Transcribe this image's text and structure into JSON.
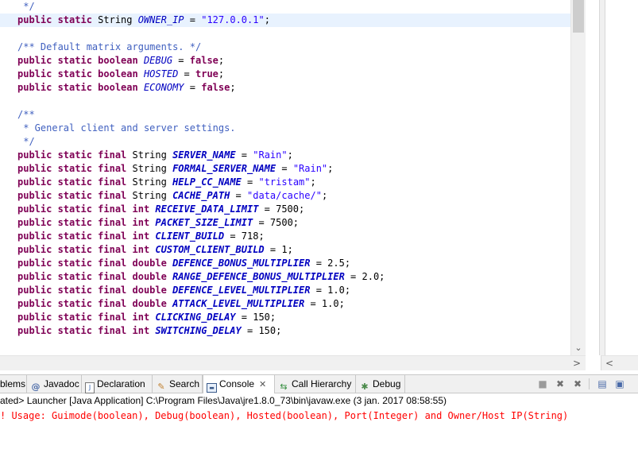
{
  "editor": {
    "lines": [
      {
        "parts": [
          {
            "t": "cm",
            "v": " */"
          }
        ]
      },
      {
        "current": true,
        "parts": [
          {
            "t": "kw",
            "v": "public static "
          },
          {
            "t": "ty",
            "v": "String "
          },
          {
            "t": "const",
            "v": "OWNER_IP"
          },
          {
            "t": "ty",
            "v": " = "
          },
          {
            "t": "str",
            "v": "\"127.0.0.1\""
          },
          {
            "t": "ty",
            "v": ";"
          }
        ]
      },
      {
        "parts": []
      },
      {
        "parts": [
          {
            "t": "cm",
            "v": "/** Default matrix arguments. */"
          }
        ]
      },
      {
        "parts": [
          {
            "t": "kw",
            "v": "public static boolean "
          },
          {
            "t": "const",
            "v": "DEBUG"
          },
          {
            "t": "ty",
            "v": " = "
          },
          {
            "t": "kw",
            "v": "false"
          },
          {
            "t": "ty",
            "v": ";"
          }
        ]
      },
      {
        "parts": [
          {
            "t": "kw",
            "v": "public static boolean "
          },
          {
            "t": "const",
            "v": "HOSTED"
          },
          {
            "t": "ty",
            "v": " = "
          },
          {
            "t": "kw",
            "v": "true"
          },
          {
            "t": "ty",
            "v": ";"
          }
        ]
      },
      {
        "parts": [
          {
            "t": "kw",
            "v": "public static boolean "
          },
          {
            "t": "const",
            "v": "ECONOMY"
          },
          {
            "t": "ty",
            "v": " = "
          },
          {
            "t": "kw",
            "v": "false"
          },
          {
            "t": "ty",
            "v": ";"
          }
        ]
      },
      {
        "parts": []
      },
      {
        "parts": [
          {
            "t": "cm",
            "v": "/**"
          }
        ]
      },
      {
        "parts": [
          {
            "t": "cm",
            "v": " * General client and server settings."
          }
        ]
      },
      {
        "parts": [
          {
            "t": "cm",
            "v": " */"
          }
        ]
      },
      {
        "parts": [
          {
            "t": "kw",
            "v": "public static final "
          },
          {
            "t": "ty",
            "v": "String "
          },
          {
            "t": "constb",
            "v": "SERVER_NAME"
          },
          {
            "t": "ty",
            "v": " = "
          },
          {
            "t": "str",
            "v": "\"Rain\""
          },
          {
            "t": "ty",
            "v": ";"
          }
        ]
      },
      {
        "parts": [
          {
            "t": "kw",
            "v": "public static final "
          },
          {
            "t": "ty",
            "v": "String "
          },
          {
            "t": "constb",
            "v": "FORMAL_SERVER_NAME"
          },
          {
            "t": "ty",
            "v": " = "
          },
          {
            "t": "str",
            "v": "\"Rain\""
          },
          {
            "t": "ty",
            "v": ";"
          }
        ]
      },
      {
        "parts": [
          {
            "t": "kw",
            "v": "public static final "
          },
          {
            "t": "ty",
            "v": "String "
          },
          {
            "t": "constb",
            "v": "HELP_CC_NAME"
          },
          {
            "t": "ty",
            "v": " = "
          },
          {
            "t": "str",
            "v": "\"tristam\""
          },
          {
            "t": "ty",
            "v": ";"
          }
        ]
      },
      {
        "parts": [
          {
            "t": "kw",
            "v": "public static final "
          },
          {
            "t": "ty",
            "v": "String "
          },
          {
            "t": "constb",
            "v": "CACHE_PATH"
          },
          {
            "t": "ty",
            "v": " = "
          },
          {
            "t": "str",
            "v": "\"data/cache/\""
          },
          {
            "t": "ty",
            "v": ";"
          }
        ]
      },
      {
        "parts": [
          {
            "t": "kw",
            "v": "public static final int "
          },
          {
            "t": "constb",
            "v": "RECEIVE_DATA_LIMIT"
          },
          {
            "t": "ty",
            "v": " = 7500;"
          }
        ]
      },
      {
        "parts": [
          {
            "t": "kw",
            "v": "public static final int "
          },
          {
            "t": "constb",
            "v": "PACKET_SIZE_LIMIT"
          },
          {
            "t": "ty",
            "v": " = 7500;"
          }
        ]
      },
      {
        "parts": [
          {
            "t": "kw",
            "v": "public static final int "
          },
          {
            "t": "constb",
            "v": "CLIENT_BUILD"
          },
          {
            "t": "ty",
            "v": " = 718;"
          }
        ]
      },
      {
        "parts": [
          {
            "t": "kw",
            "v": "public static final int "
          },
          {
            "t": "constb",
            "v": "CUSTOM_CLIENT_BUILD"
          },
          {
            "t": "ty",
            "v": " = 1;"
          }
        ]
      },
      {
        "parts": [
          {
            "t": "kw",
            "v": "public static final double "
          },
          {
            "t": "constb",
            "v": "DEFENCE_BONUS_MULTIPLIER"
          },
          {
            "t": "ty",
            "v": " = 2.5;"
          }
        ]
      },
      {
        "parts": [
          {
            "t": "kw",
            "v": "public static final double "
          },
          {
            "t": "constb",
            "v": "RANGE_DEFENCE_BONUS_MULTIPLIER"
          },
          {
            "t": "ty",
            "v": " = 2.0;"
          }
        ]
      },
      {
        "parts": [
          {
            "t": "kw",
            "v": "public static final double "
          },
          {
            "t": "constb",
            "v": "DEFENCE_LEVEL_MULTIPLIER"
          },
          {
            "t": "ty",
            "v": " = 1.0;"
          }
        ]
      },
      {
        "parts": [
          {
            "t": "kw",
            "v": "public static final double "
          },
          {
            "t": "constb",
            "v": "ATTACK_LEVEL_MULTIPLIER"
          },
          {
            "t": "ty",
            "v": " = 1.0;"
          }
        ]
      },
      {
        "parts": [
          {
            "t": "kw",
            "v": "public static final int "
          },
          {
            "t": "constb",
            "v": "CLICKING_DELAY"
          },
          {
            "t": "ty",
            "v": " = 150;"
          }
        ]
      },
      {
        "parts": [
          {
            "t": "kw",
            "v": "public static final int "
          },
          {
            "t": "constb",
            "v": "SWITCHING_DELAY"
          },
          {
            "t": "ty",
            "v": " = 150;"
          }
        ]
      }
    ]
  },
  "tabs": {
    "problems": "blems",
    "javadoc": "Javadoc",
    "declaration": "Declaration",
    "search": "Search",
    "console": "Console",
    "console_close": "✕",
    "call_hierarchy": "Call Hierarchy",
    "debug": "Debug"
  },
  "icons": {
    "problems": "problems-icon",
    "javadoc": "javadoc-icon",
    "declaration": "declaration-icon",
    "search": "search-icon",
    "console": "console-icon",
    "call_hierarchy": "call-hierarchy-icon",
    "debug": "debug-icon"
  },
  "toolbar": {
    "terminate": "■",
    "remove_launch": "✖",
    "remove_all": "✖",
    "scroll_lock": "▤",
    "pin": "▣"
  },
  "console": {
    "header": "ated> Launcher [Java Application] C:\\Program Files\\Java\\jre1.8.0_73\\bin\\javaw.exe (3 jan. 2017 08:58:55)",
    "output": "! Usage: Guimode(boolean), Debug(boolean), Hosted(boolean), Port(Integer) and Owner/Host IP(String)"
  },
  "colors": {
    "keyword": "#7f0055",
    "constant": "#0000c0",
    "string": "#2a00ff",
    "comment": "#3f5fbf",
    "error_output": "#ff0000",
    "current_line": "#e8f2fe"
  }
}
